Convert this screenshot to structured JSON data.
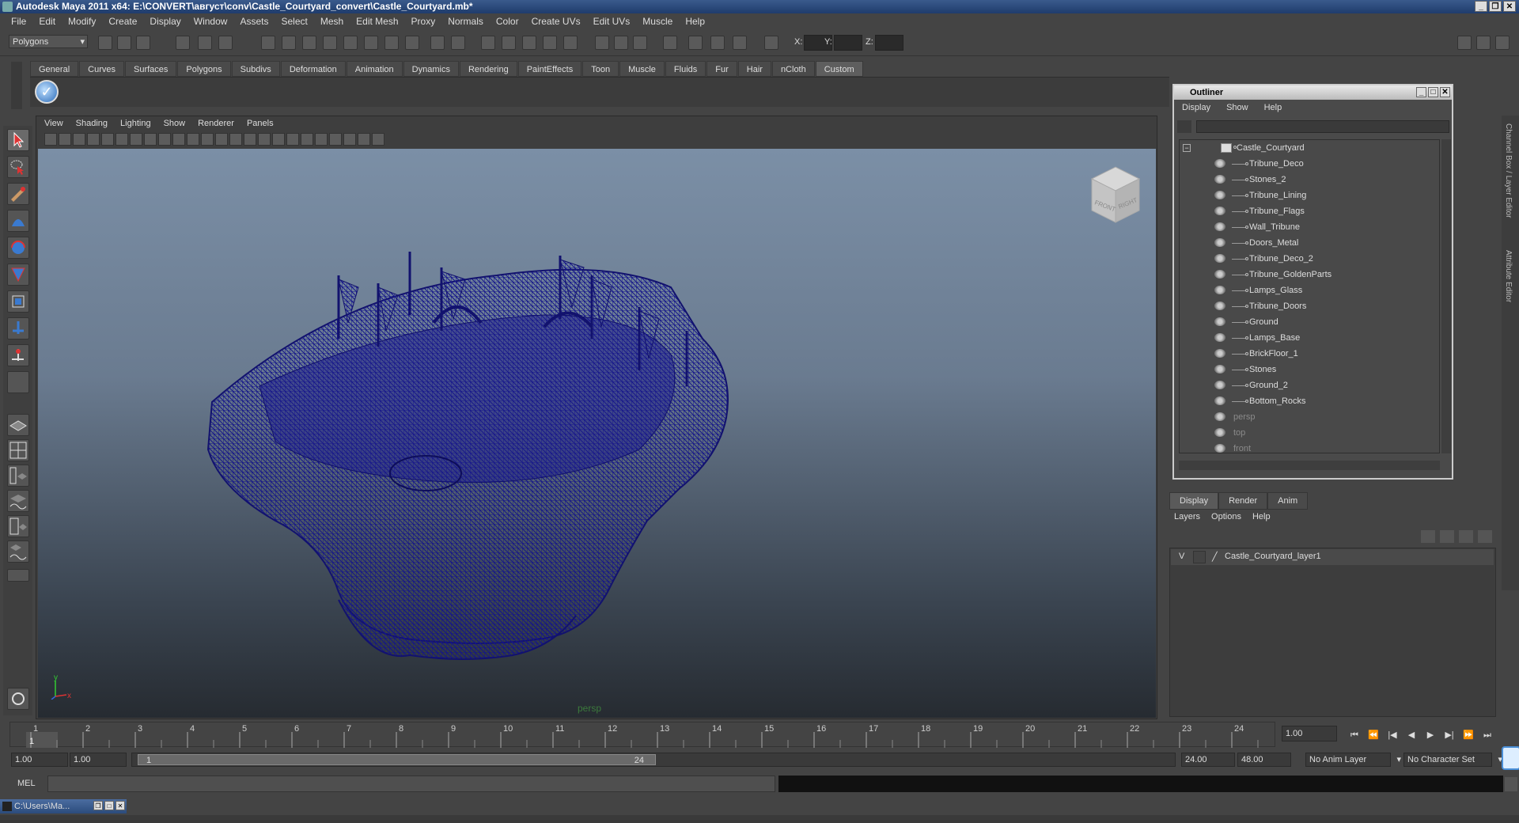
{
  "window": {
    "title": "Autodesk Maya 2011 x64: E:\\CONVERT\\август\\conv\\Castle_Courtyard_convert\\Castle_Courtyard.mb*"
  },
  "menubar": [
    "File",
    "Edit",
    "Modify",
    "Create",
    "Display",
    "Window",
    "Assets",
    "Select",
    "Mesh",
    "Edit Mesh",
    "Proxy",
    "Normals",
    "Color",
    "Create UVs",
    "Edit UVs",
    "Muscle",
    "Help"
  ],
  "status_line": {
    "mode": "Polygons",
    "coord_labels": [
      "X:",
      "Y:",
      "Z:"
    ]
  },
  "shelf_tabs": [
    "General",
    "Curves",
    "Surfaces",
    "Polygons",
    "Subdivs",
    "Deformation",
    "Animation",
    "Dynamics",
    "Rendering",
    "PaintEffects",
    "Toon",
    "Muscle",
    "Fluids",
    "Fur",
    "Hair",
    "nCloth",
    "Custom"
  ],
  "shelf_active": "Custom",
  "viewport": {
    "menu": [
      "View",
      "Shading",
      "Lighting",
      "Show",
      "Renderer",
      "Panels"
    ],
    "camera_label": "persp",
    "viewcube": {
      "front": "FRONT",
      "right": "RIGHT"
    },
    "axis_labels": {
      "y": "y",
      "x": "x"
    }
  },
  "outliner": {
    "title": "Outliner",
    "menu": [
      "Display",
      "Show",
      "Help"
    ],
    "root": "Castle_Courtyard",
    "children": [
      "Tribune_Deco",
      "Stones_2",
      "Tribune_Lining",
      "Tribune_Flags",
      "Wall_Tribune",
      "Doors_Metal",
      "Tribune_Deco_2",
      "Tribune_GoldenParts",
      "Lamps_Glass",
      "Tribune_Doors",
      "Ground",
      "Lamps_Base",
      "BrickFloor_1",
      "Stones",
      "Ground_2",
      "Bottom_Rocks"
    ],
    "cameras": [
      "persp",
      "top",
      "front"
    ]
  },
  "layer_editor": {
    "tabs": [
      "Display",
      "Render",
      "Anim"
    ],
    "active_tab": "Display",
    "menu": [
      "Layers",
      "Options",
      "Help"
    ],
    "layers": [
      {
        "visible": "V",
        "name": "Castle_Courtyard_layer1"
      }
    ]
  },
  "side_tabs": [
    "Channel Box / Layer Editor",
    "Attribute Editor"
  ],
  "timeline": {
    "frames": [
      "1",
      "2",
      "3",
      "4",
      "5",
      "6",
      "7",
      "8",
      "9",
      "10",
      "11",
      "12",
      "13",
      "14",
      "15",
      "16",
      "17",
      "18",
      "19",
      "20",
      "21",
      "22",
      "23",
      "24"
    ],
    "current_frame_marker": "1",
    "current_time": "1.00"
  },
  "range_slider": {
    "start": "1.00",
    "playback_start": "1.00",
    "slider_start": "1",
    "slider_end": "24",
    "playback_end": "24.00",
    "end": "48.00",
    "anim_layer": "No Anim Layer",
    "character_set": "No Character Set"
  },
  "command_line": {
    "label": "MEL"
  },
  "taskbar": {
    "label": "C:\\Users\\Ma..."
  }
}
